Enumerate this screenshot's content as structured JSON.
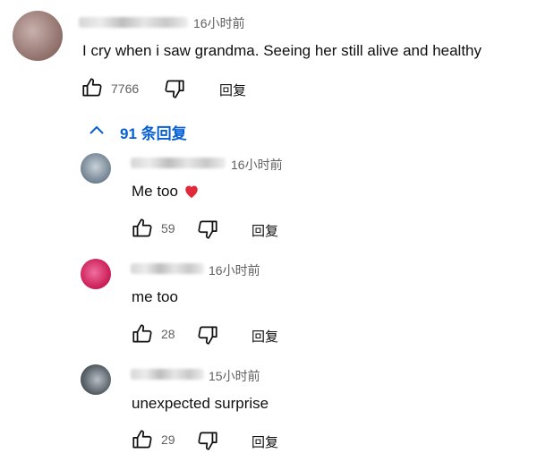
{
  "comment": {
    "time": "16小时前",
    "text": "I cry when i saw grandma. Seeing her still alive and healthy",
    "likes": "7766",
    "reply_label": "回复"
  },
  "replies_toggle": {
    "label": "91 条回复"
  },
  "replies": [
    {
      "time": "16小时前",
      "text": "Me too",
      "emoji": "heart-emoji",
      "likes": "59",
      "reply_label": "回复"
    },
    {
      "time": "16小时前",
      "text": "me too",
      "likes": "28",
      "reply_label": "回复"
    },
    {
      "time": "15小时前",
      "text": "unexpected surprise",
      "likes": "29",
      "reply_label": "回复"
    }
  ],
  "icons": [
    "thumb-up-icon",
    "thumb-down-icon",
    "chevron-up-icon",
    "heart-emoji"
  ],
  "colors": {
    "link": "#065fd4",
    "text": "#0f0f0f",
    "meta": "#606060",
    "heart": "#e02a3a"
  }
}
